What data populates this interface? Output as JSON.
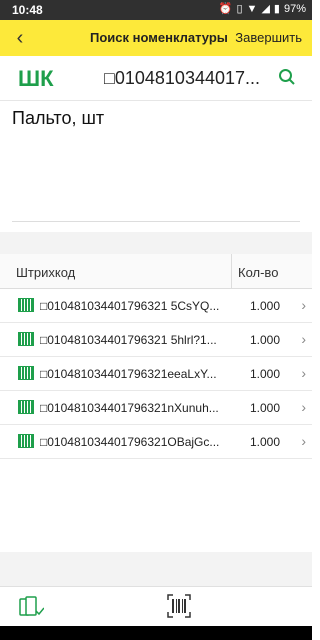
{
  "status": {
    "time": "10:48",
    "battery": "97%"
  },
  "toolbar": {
    "back_icon": "arrow-left-icon",
    "title": "Поиск номенклатуры",
    "finish_label": "Завершить"
  },
  "search": {
    "label": "ШК",
    "value": "□0104810344017...",
    "search_icon": "search-icon"
  },
  "item": {
    "name": "Пальто, шт"
  },
  "table": {
    "headers": {
      "barcode": "Штрихкод",
      "qty": "Кол-во"
    },
    "rows": [
      {
        "code": "□010481034401796321 5CsYQ...",
        "qty": "1.000"
      },
      {
        "code": "□010481034401796321 5hlrl?1...",
        "qty": "1.000"
      },
      {
        "code": "□010481034401796321eeaLxY...",
        "qty": "1.000"
      },
      {
        "code": "□010481034401796321nXunuh...",
        "qty": "1.000"
      },
      {
        "code": "□010481034401796321OBajGc...",
        "qty": "1.000"
      }
    ]
  },
  "colors": {
    "toolbar": "#fde93a",
    "accent": "#1e9f4b"
  }
}
